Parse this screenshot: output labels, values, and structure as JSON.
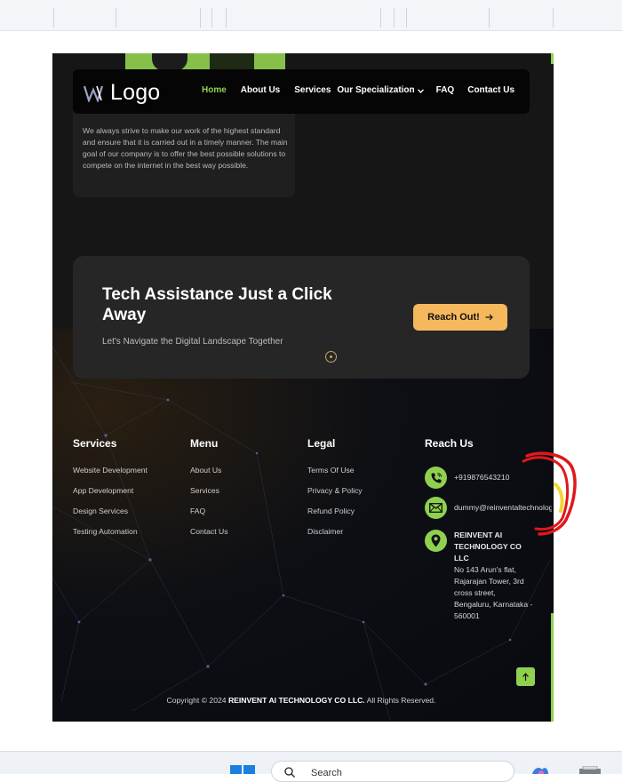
{
  "header": {
    "logo_text": "Logo",
    "nav": [
      {
        "label": "Home",
        "active": true
      },
      {
        "label": "About Us"
      },
      {
        "label": "Services"
      },
      {
        "label": "Our Specialization",
        "dropdown": true
      },
      {
        "label": "FAQ"
      },
      {
        "label": "Contact Us"
      }
    ]
  },
  "about": {
    "text": "We always strive to make our work of the highest standard and ensure that it is carried out in a timely manner. The main goal of our company is to offer the best possible solutions to compete on the internet in the best way possible."
  },
  "cta": {
    "title": "Tech Assistance Just a Click Away",
    "subtitle": "Let's Navigate the Digital Landscape Together",
    "button_label": "Reach Out!"
  },
  "footer": {
    "services": {
      "title": "Services",
      "items": [
        "Website Development",
        "App Development",
        "Design Services",
        "Testing Automation"
      ]
    },
    "menu": {
      "title": "Menu",
      "items": [
        "About Us",
        "Services",
        "FAQ",
        "Contact Us"
      ]
    },
    "legal": {
      "title": "Legal",
      "items": [
        "Terms Of Use",
        "Privacy & Policy",
        "Refund Policy",
        "Disclaimer"
      ]
    },
    "reach": {
      "title": "Reach Us",
      "phone": "+919876543210",
      "email": "dummy@reinventaltechnologies",
      "company": "REINVENT AI TECHNOLOGY CO LLC",
      "address": "No 143 Arun's flat, Rajarajan Tower, 3rd cross street, Bengaluru, Karnataka - 560001"
    },
    "copyright_prefix": "Copyright © 2024",
    "copyright_company": "REINVENT AI TECHNOLOGY CO LLC.",
    "copyright_suffix": "All Rights Reserved."
  },
  "taskbar": {
    "search_text": "Search"
  },
  "colors": {
    "accent_green": "#8fd14f",
    "cta_button": "#f5b85c",
    "annotation_red": "#e0171b"
  }
}
